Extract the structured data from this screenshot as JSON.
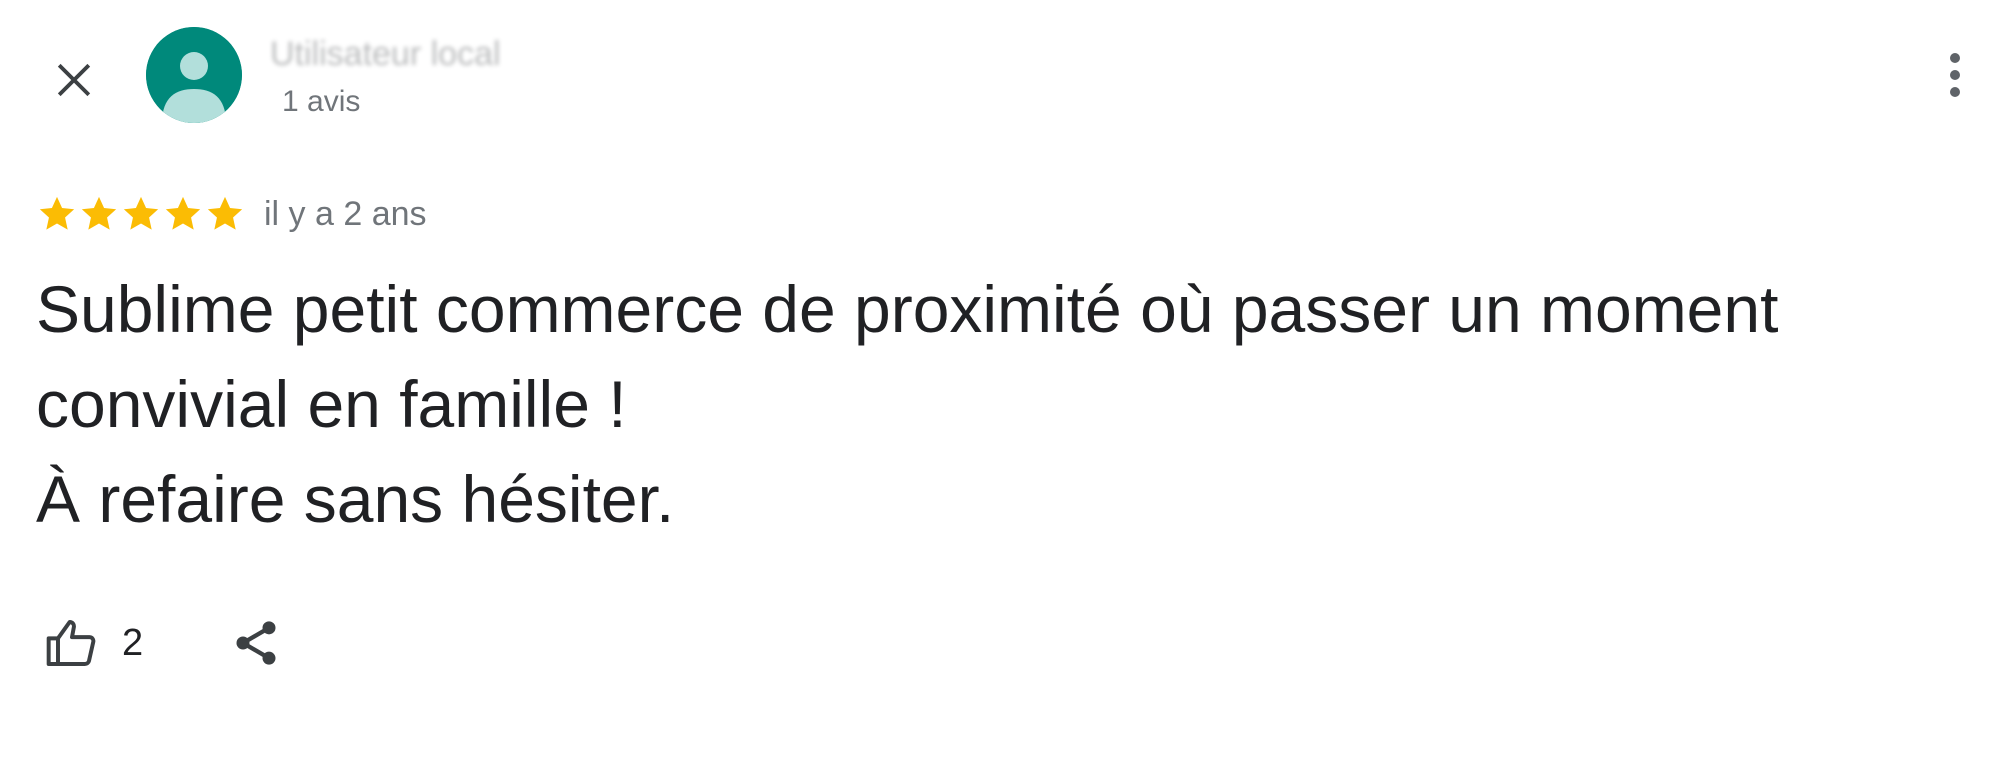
{
  "header": {
    "reviewer_name": "Utilisateur local",
    "reviewer_meta": "1 avis"
  },
  "review": {
    "rating": 5,
    "rating_max": 5,
    "date": "il y a 2 ans",
    "text": "Sublime petit commerce de proximité où passer un moment convivial en famille !\nÀ refaire sans hésiter.",
    "like_count": "2"
  },
  "colors": {
    "star": "#fbbc04",
    "avatar_bg": "#00897b",
    "avatar_figure": "#b2dfdb",
    "icon": "#3c4043"
  },
  "icons": {
    "close": "close-icon",
    "more": "more-vert-icon",
    "like": "thumb-up-icon",
    "share": "share-icon"
  }
}
